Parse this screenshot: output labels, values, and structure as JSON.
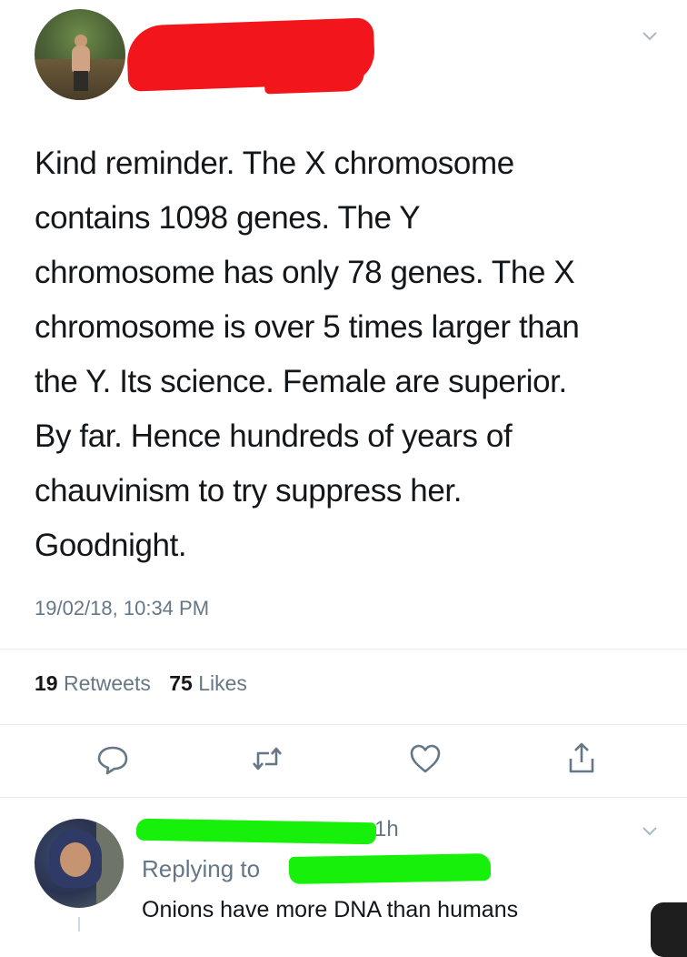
{
  "tweet": {
    "text": "Kind reminder. The X chromosome\ncontains 1098 genes. The Y\nchromosome has only 78 genes. The X\nchromosome is over 5 times larger than\nthe Y. Its science. Female are superior.\nBy far. Hence hundreds of years of\nchauvinism to try suppress her.\nGoodnight.",
    "timestamp": "19/02/18, 10:34 PM",
    "retweets_count": "19",
    "retweets_label": "Retweets",
    "likes_count": "75",
    "likes_label": "Likes"
  },
  "reply": {
    "time": "1h",
    "replying_to_label": "Replying to",
    "text": "Onions have more DNA than humans"
  },
  "colors": {
    "redaction_red": "#f2151b",
    "redaction_green": "#16f00a",
    "meta_gray": "#657786",
    "text_dark": "#14171a"
  },
  "icons": {
    "menu": "chevron-down-icon",
    "actions": [
      "reply-icon",
      "retweet-icon",
      "like-icon",
      "share-icon"
    ]
  }
}
